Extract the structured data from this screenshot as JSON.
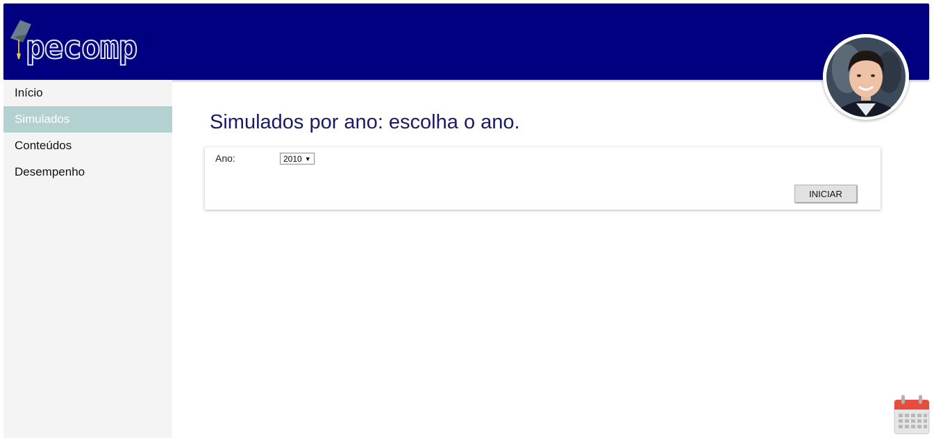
{
  "header": {
    "logo_text": "pecomp",
    "background": "#000080"
  },
  "sidebar": {
    "items": [
      {
        "label": "Início",
        "active": false
      },
      {
        "label": "Simulados",
        "active": true
      },
      {
        "label": "Conteúdos",
        "active": false
      },
      {
        "label": "Desempenho",
        "active": false
      }
    ]
  },
  "main": {
    "title": "Simulados por ano: escolha o ano.",
    "form": {
      "year_label": "Ano:",
      "year_selected": "2010",
      "start_button": "INICIAR"
    }
  },
  "icons": {
    "logo_cap": "graduation-cap-icon",
    "avatar": "user-avatar",
    "calendar": "calendar-icon"
  },
  "colors": {
    "header_bg": "#000080",
    "sidebar_bg": "#f4f4f4",
    "active_item_bg": "#b3d1d1",
    "title": "#1a1a66"
  }
}
